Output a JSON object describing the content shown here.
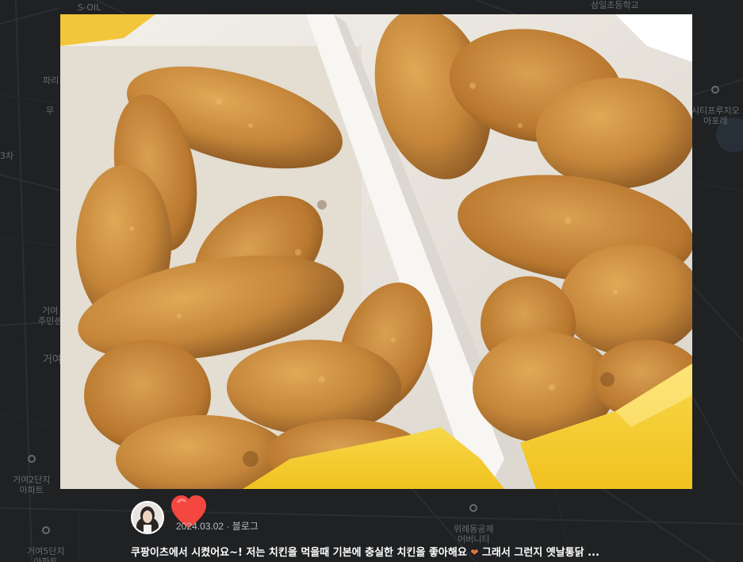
{
  "map": {
    "labels": {
      "soil": "S-OIL",
      "top_left": "파리",
      "mid_left": "무",
      "lane": "3차",
      "apt_left_1": "거여\n주민센",
      "apt_left_2": "거여",
      "apt_left_3": "거여2단지\n아파트",
      "apt_left_4": "거여5단지\n아파트",
      "right_poi": "시티프루지오\n아포레",
      "top_right": "삼일초등학교",
      "bottom_center": "위례동공제\n어버니티"
    }
  },
  "post": {
    "date": "2024.03.02",
    "separator": "·",
    "source": "블로그",
    "snippet": "쿠팡이츠에서 시켰어요~! 저는 치킨을 먹을때 기본에 충실한 치킨을 좋아해요",
    "snippet_heart": "❤",
    "snippet_tail": " 그래서 그런지 옛날통닭 ..."
  },
  "colors": {
    "heart": "#f4473f",
    "box_yellow": "#f6cf33",
    "chicken": "#c88a3e"
  },
  "icons": {
    "heart": "heart-icon",
    "avatar": "user-avatar"
  }
}
